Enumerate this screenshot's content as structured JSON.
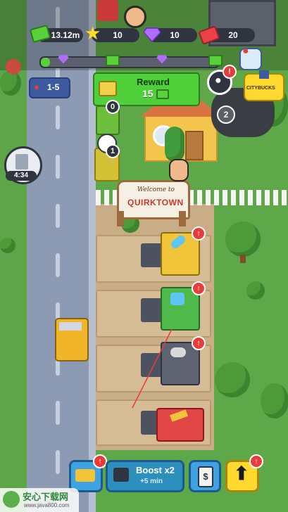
{
  "hud": {
    "cash": "13.12m",
    "stars": "10",
    "gems": "10",
    "tickets": "20"
  },
  "progress": {
    "fraction": 0.05
  },
  "reward": {
    "title": "Reward",
    "amount": "15"
  },
  "level_badge": "1-5",
  "trash_timer": "4:34",
  "sign": {
    "line1": "Welcome to",
    "line2": "QUIRKTOWN"
  },
  "city_button": "CITYBUCKS",
  "bin_counts": {
    "blue": "1",
    "green_top": "0",
    "pile": "2"
  },
  "bottom_bar": {
    "boost_title": "Boost x2",
    "boost_sub": "+5 min",
    "shop_symbol": "$"
  },
  "watermark": {
    "title": "安心下载网",
    "url": "www.java800.com"
  },
  "colors": {
    "cash_green": "#5ad13a",
    "gem_purple": "#b06cff",
    "star_yellow": "#ffd92e",
    "ticket_red": "#e8434a",
    "upgrade_red": "#e83b3b"
  }
}
